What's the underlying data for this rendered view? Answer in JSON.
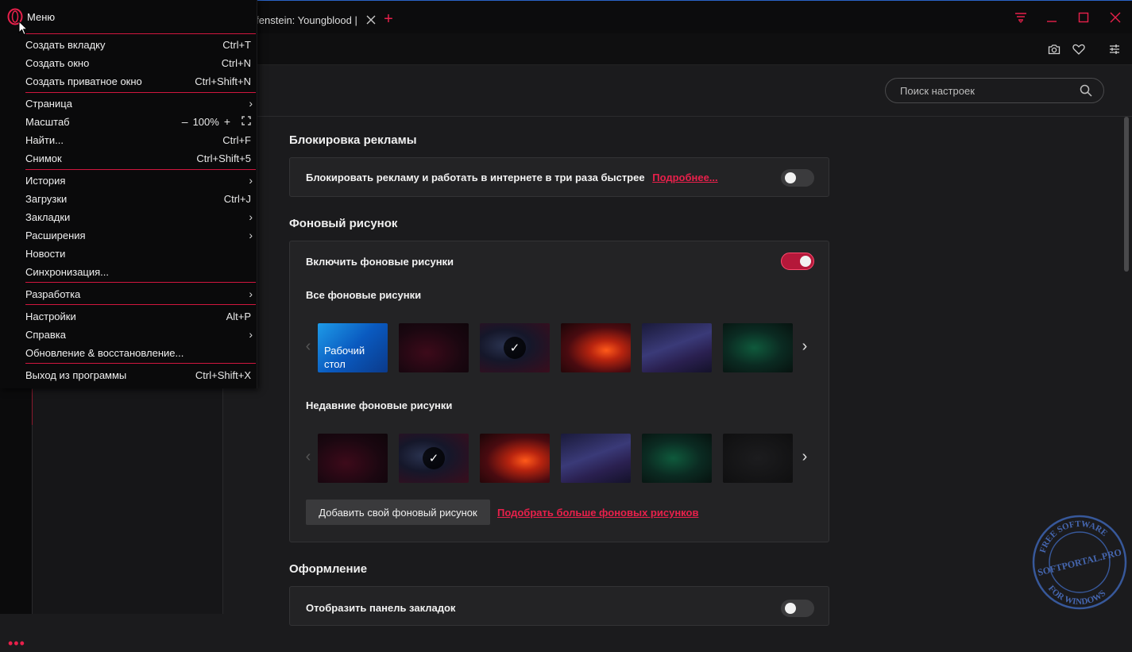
{
  "window": {
    "tab_title": "Wolfenstein: Youngblood |",
    "colors": {
      "accent": "#e8204b",
      "toggle_on": "#b5183a",
      "background": "#1b1b1d"
    }
  },
  "menu": {
    "title": "Меню",
    "items": [
      {
        "label": "Создать вкладку",
        "shortcut": "Ctrl+T"
      },
      {
        "label": "Создать окно",
        "shortcut": "Ctrl+N"
      },
      {
        "label": "Создать приватное окно",
        "shortcut": "Ctrl+Shift+N"
      },
      {
        "label": "Страница",
        "shortcut": ""
      },
      {
        "label": "Масштаб",
        "shortcut": ""
      },
      {
        "label": "Найти...",
        "shortcut": "Ctrl+F"
      },
      {
        "label": "Снимок",
        "shortcut": "Ctrl+Shift+5"
      },
      {
        "label": "История",
        "shortcut": ""
      },
      {
        "label": "Загрузки",
        "shortcut": "Ctrl+J"
      },
      {
        "label": "Закладки",
        "shortcut": ""
      },
      {
        "label": "Расширения",
        "shortcut": ""
      },
      {
        "label": "Новости",
        "shortcut": ""
      },
      {
        "label": "Синхронизация...",
        "shortcut": ""
      },
      {
        "label": "Разработка",
        "shortcut": ""
      },
      {
        "label": "Настройки",
        "shortcut": "Alt+P"
      },
      {
        "label": "Справка",
        "shortcut": ""
      },
      {
        "label": "Обновление & восстановление...",
        "shortcut": ""
      },
      {
        "label": "Выход из программы",
        "shortcut": "Ctrl+Shift+X"
      }
    ],
    "zoom": {
      "minus": "–",
      "value": "100%",
      "plus": "+"
    }
  },
  "settings": {
    "search_placeholder": "Поиск настроек",
    "adblock": {
      "title": "Блокировка рекламы",
      "label": "Блокировать рекламу и работать в интернете в три раза быстрее",
      "link": "Подробнее...",
      "enabled": false
    },
    "wallpapers": {
      "title": "Фоновый рисунок",
      "enable_label": "Включить фоновые рисунки",
      "enabled": true,
      "all_label": "Все фоновые рисунки",
      "desktop_label": "Рабочий стол",
      "recent_label": "Недавние фоновые рисунки",
      "add_button": "Добавить свой фоновый рисунок",
      "more_link": "Подобрать больше фоновых рисунков"
    },
    "appearance": {
      "title": "Оформление",
      "bookmarks_bar_label": "Отобразить панель закладок",
      "bookmarks_bar_enabled": false
    }
  },
  "watermark": {
    "top": "FREE SOFTWARE",
    "middle": "SOFTPORTAL.PRO",
    "bottom": "FOR WINDOWS"
  }
}
